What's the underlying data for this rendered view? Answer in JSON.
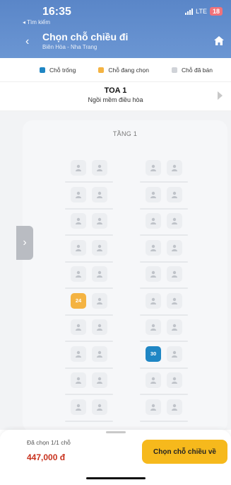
{
  "status_bar": {
    "time": "16:35",
    "back_app": "◂ Tìm kiếm",
    "network": "LTE",
    "battery": "18"
  },
  "header": {
    "title": "Chọn chỗ chiều đi",
    "subtitle": "Biên Hòa - Nha Trang"
  },
  "legend": [
    {
      "label": "Chỗ trống",
      "color": "#1f86c4"
    },
    {
      "label": "Chỗ đang chọn",
      "color": "#f4b342"
    },
    {
      "label": "Chỗ đã bán",
      "color": "#d0d3d8"
    }
  ],
  "coach": {
    "name": "TOA 1",
    "type": "Ngồi mềm điều hòa"
  },
  "floor": "TẦNG 1",
  "seat_rows": [
    {
      "left": [
        {
          "label": "",
          "state": "sold"
        },
        {
          "label": "",
          "state": "sold"
        }
      ],
      "right": [
        {
          "label": "",
          "state": "sold"
        },
        {
          "label": "",
          "state": "sold"
        }
      ]
    },
    {
      "left": [
        {
          "label": "",
          "state": "sold"
        },
        {
          "label": "",
          "state": "sold"
        }
      ],
      "right": [
        {
          "label": "",
          "state": "sold"
        },
        {
          "label": "",
          "state": "sold"
        }
      ]
    },
    {
      "left": [
        {
          "label": "",
          "state": "sold"
        },
        {
          "label": "",
          "state": "sold"
        }
      ],
      "right": [
        {
          "label": "",
          "state": "sold"
        },
        {
          "label": "",
          "state": "sold"
        }
      ]
    },
    {
      "left": [
        {
          "label": "",
          "state": "sold"
        },
        {
          "label": "",
          "state": "sold"
        }
      ],
      "right": [
        {
          "label": "",
          "state": "sold"
        },
        {
          "label": "",
          "state": "sold"
        }
      ]
    },
    {
      "left": [
        {
          "label": "",
          "state": "sold"
        },
        {
          "label": "",
          "state": "sold"
        }
      ],
      "right": [
        {
          "label": "",
          "state": "sold"
        },
        {
          "label": "",
          "state": "sold"
        }
      ]
    },
    {
      "left": [
        {
          "label": "24",
          "state": "selected"
        },
        {
          "label": "",
          "state": "sold"
        }
      ],
      "right": [
        {
          "label": "",
          "state": "sold"
        },
        {
          "label": "",
          "state": "sold"
        }
      ]
    },
    {
      "left": [
        {
          "label": "",
          "state": "sold"
        },
        {
          "label": "",
          "state": "sold"
        }
      ],
      "right": [
        {
          "label": "",
          "state": "sold"
        },
        {
          "label": "",
          "state": "sold"
        }
      ]
    },
    {
      "left": [
        {
          "label": "",
          "state": "sold"
        },
        {
          "label": "",
          "state": "sold"
        }
      ],
      "right": [
        {
          "label": "30",
          "state": "available"
        },
        {
          "label": "",
          "state": "sold"
        }
      ]
    },
    {
      "left": [
        {
          "label": "",
          "state": "sold"
        },
        {
          "label": "",
          "state": "sold"
        }
      ],
      "right": [
        {
          "label": "",
          "state": "sold"
        },
        {
          "label": "",
          "state": "sold"
        }
      ]
    },
    {
      "left": [
        {
          "label": "",
          "state": "sold"
        },
        {
          "label": "",
          "state": "sold"
        }
      ],
      "right": [
        {
          "label": "",
          "state": "sold"
        },
        {
          "label": "",
          "state": "sold"
        }
      ]
    }
  ],
  "summary": {
    "selected_count": "Đã chọn 1/1 chỗ",
    "total_price": "447,000 đ",
    "confirm_label": "Chọn chỗ chiều về"
  }
}
